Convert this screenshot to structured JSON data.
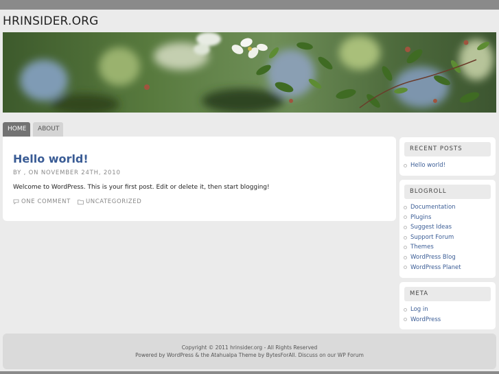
{
  "site": {
    "title": "HRINSIDER.ORG"
  },
  "nav": {
    "items": [
      "HOME",
      "ABOUT"
    ]
  },
  "post": {
    "title": "Hello world!",
    "meta": "BY , ON NOVEMBER 24TH, 2010",
    "body": "Welcome to WordPress. This is your first post. Edit or delete it, then start blogging!",
    "comments": "ONE COMMENT",
    "category": "UNCATEGORIZED"
  },
  "sidebar": {
    "recent_posts": {
      "title": "RECENT POSTS",
      "items": [
        "Hello world!"
      ]
    },
    "blogroll": {
      "title": "BLOGROLL",
      "items": [
        "Documentation",
        "Plugins",
        "Suggest Ideas",
        "Support Forum",
        "Themes",
        "WordPress Blog",
        "WordPress Planet"
      ]
    },
    "meta": {
      "title": "META",
      "items": [
        "Log in",
        "WordPress"
      ]
    }
  },
  "footer": {
    "line1": "Copyright © 2011 hrinsider.org - All Rights Reserved",
    "line2": "Powered by WordPress & the Atahualpa Theme by BytesForAll. Discuss on our WP Forum"
  },
  "colors": {
    "link": "#3a5c95",
    "nav_active": "#737373",
    "nav_normal": "#d4d4d4",
    "background": "#ebebeb"
  }
}
